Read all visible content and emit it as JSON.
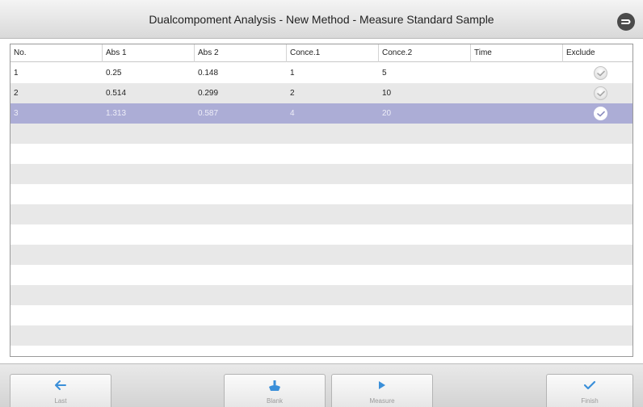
{
  "window": {
    "title": "Dualcompoment Analysis - New Method - Measure Standard Sample"
  },
  "icons": {
    "back": "back-return-icon",
    "exclude": "check-icon",
    "last": "arrow-left-icon",
    "blank": "blank-flask-icon",
    "measure": "play-icon",
    "finish": "checkmark-icon"
  },
  "colors": {
    "accent": "#3a8fd9",
    "selected_row": "#acadd6",
    "stripe": "#e8e8e8"
  },
  "table": {
    "columns": [
      "No.",
      "Abs 1",
      "Abs 2",
      "Conce.1",
      "Conce.2",
      "Time",
      "Exclude"
    ],
    "rows": [
      {
        "no": "1",
        "abs1": "0.25",
        "abs2": "0.148",
        "conc1": "1",
        "conc2": "5",
        "time": "",
        "selected": false
      },
      {
        "no": "2",
        "abs1": "0.514",
        "abs2": "0.299",
        "conc1": "2",
        "conc2": "10",
        "time": "",
        "selected": false
      },
      {
        "no": "3",
        "abs1": "1.313",
        "abs2": "0.587",
        "conc1": "4",
        "conc2": "20",
        "time": "",
        "selected": true
      }
    ]
  },
  "toolbar": {
    "last_label": "Last",
    "blank_label": "Blank",
    "measure_label": "Measure",
    "finish_label": "Finish"
  }
}
